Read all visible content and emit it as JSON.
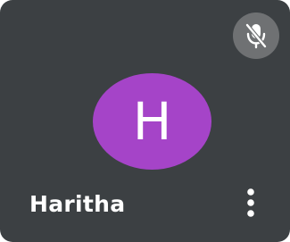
{
  "participant": {
    "name": "Haritha",
    "initial": "H",
    "avatar_color": "#a544c8",
    "microphone_muted": true
  },
  "tile": {
    "background_color": "#3c4043"
  },
  "icons": {
    "mute": "mic-off-icon",
    "more": "more-vert-icon"
  }
}
